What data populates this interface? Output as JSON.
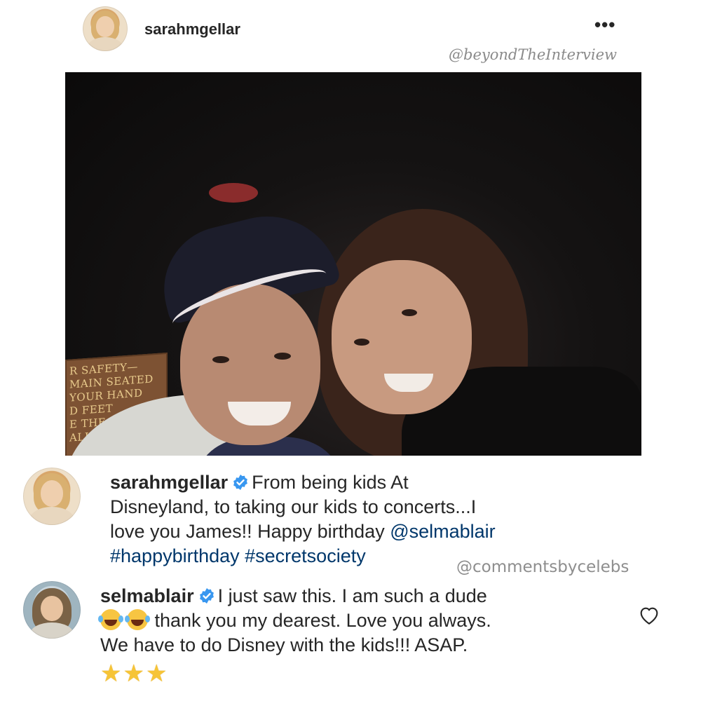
{
  "post": {
    "username": "sarahmgellar",
    "more_icon": "more-dots-icon",
    "watermark": "@beyondTheInterview"
  },
  "photo": {
    "sign_lines": [
      "R SAFETY—",
      "MAIN SEATED",
      "YOUR HAND",
      "D FEET",
      "E THE CAR",
      "ALL TIMES"
    ]
  },
  "comments": [
    {
      "username": "sarahmgellar",
      "verified": true,
      "lines": [
        "From being kids At",
        "Disneyland, to taking our kids to concerts...I",
        "love you James!! Happy birthday "
      ],
      "mention": "@selmablair",
      "hashtags": "#happybirthday #secretsociety"
    },
    {
      "username": "selmablair",
      "verified": true,
      "line1": "I just saw this. I am such a dude",
      "line2": " thank you my dearest. Love you always.",
      "line3": "We have to do Disney with the kids!!! ASAP.",
      "emoji_laugh": "face-with-tears-of-joy-icon",
      "stars": [
        "☆",
        "☆",
        "☆"
      ],
      "like_icon": "heart-outline-icon"
    }
  ],
  "watermark2": "@commentsbycelebs",
  "colors": {
    "link": "#00376b",
    "verified": "#3897f0",
    "text": "#262626"
  }
}
